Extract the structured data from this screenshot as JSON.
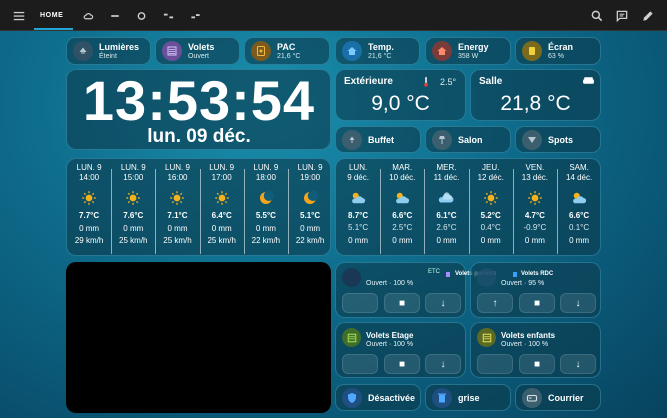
{
  "topbar": {
    "tab_home": "HOME"
  },
  "pills": {
    "lumieres": {
      "title": "Lumières",
      "sub": "Éteint"
    },
    "volets": {
      "title": "Volets",
      "sub": "Ouvert"
    },
    "pac": {
      "title": "PAC",
      "sub": "21,6 °C"
    },
    "temp": {
      "title": "Temp.",
      "sub": "21,6 °C"
    },
    "energy": {
      "title": "Energy",
      "sub": "358 W"
    },
    "ecran": {
      "title": "Écran",
      "sub": "63 %"
    }
  },
  "clock": {
    "time": "13:53:54",
    "date": "lun. 09 déc."
  },
  "exterieure": {
    "title": "Extérieure",
    "feel": "2.5°",
    "value": "9,0 °C"
  },
  "salle": {
    "title": "Salle",
    "value": "21,8 °C"
  },
  "rooms": {
    "buffet": "Buffet",
    "salon": "Salon",
    "spots": "Spots"
  },
  "hourly": [
    {
      "day": "LUN. 9",
      "time": "14:00",
      "icon": "sun",
      "temp": "7.7°C",
      "rain": "0 mm",
      "wind": "29 km/h"
    },
    {
      "day": "LUN. 9",
      "time": "15:00",
      "icon": "sun",
      "temp": "7.6°C",
      "rain": "0 mm",
      "wind": "25 km/h"
    },
    {
      "day": "LUN. 9",
      "time": "16:00",
      "icon": "sun",
      "temp": "7.1°C",
      "rain": "0 mm",
      "wind": "25 km/h"
    },
    {
      "day": "LUN. 9",
      "time": "17:00",
      "icon": "sun",
      "temp": "6.4°C",
      "rain": "0 mm",
      "wind": "25 km/h"
    },
    {
      "day": "LUN. 9",
      "time": "18:00",
      "icon": "moon",
      "temp": "5.5°C",
      "rain": "0 mm",
      "wind": "22 km/h"
    },
    {
      "day": "LUN. 9",
      "time": "19:00",
      "icon": "moon",
      "temp": "5.1°C",
      "rain": "0 mm",
      "wind": "22 km/h"
    }
  ],
  "daily": [
    {
      "day": "LUN.",
      "date": "9 déc.",
      "icon": "partly",
      "high": "8.7°C",
      "low": "5.1°C",
      "rain": "0 mm"
    },
    {
      "day": "MAR.",
      "date": "10 déc.",
      "icon": "partly",
      "high": "6.6°C",
      "low": "2.5°C",
      "rain": "0 mm"
    },
    {
      "day": "MER.",
      "date": "11 déc.",
      "icon": "cloud",
      "high": "6.1°C",
      "low": "2.6°C",
      "rain": "0 mm"
    },
    {
      "day": "JEU.",
      "date": "12 déc.",
      "icon": "sun",
      "high": "5.2°C",
      "low": "0.4°C",
      "rain": "0 mm"
    },
    {
      "day": "VEN.",
      "date": "13 déc.",
      "icon": "sun",
      "high": "4.7°C",
      "low": "-0.9°C",
      "rain": "0 mm"
    },
    {
      "day": "SAM.",
      "date": "14 déc.",
      "icon": "partly",
      "high": "6.6°C",
      "low": "0.1°C",
      "rain": "0 mm"
    }
  ],
  "shutters": {
    "parents": {
      "title": "Volets parents",
      "sub": "Ouvert · 100 %",
      "tag": "ETC"
    },
    "rdc": {
      "title": "Volets RDC",
      "sub": "Ouvert · 95 %"
    },
    "etage": {
      "title": "Volets Etage",
      "sub": "Ouvert · 100 %"
    },
    "enfants": {
      "title": "Volets enfants",
      "sub": "Ouvert · 100 %"
    },
    "stop_glyph": "■",
    "down_glyph": "↓",
    "up_glyph": "↑"
  },
  "bottom": {
    "alarm": "Désactivée",
    "grise": "grise",
    "courrier": "Courrier"
  },
  "colors": {
    "accent": "#22a4d4",
    "sun": "#f6b21a",
    "moon": "#f6a51a"
  }
}
